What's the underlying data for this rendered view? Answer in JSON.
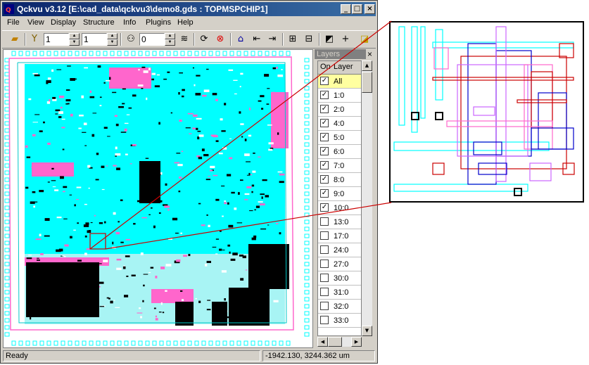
{
  "window": {
    "title": "Qckvu v3.12 [E:\\cad_data\\qckvu3\\demo8.gds : TOPMSPCHIP1]",
    "controls": {
      "minimize": "_",
      "maximize": "□",
      "close": "×"
    }
  },
  "menu": {
    "items": [
      "File",
      "View",
      "Display",
      "Structure",
      "Info",
      "Plugins",
      "Help"
    ]
  },
  "toolbar": {
    "spin1_value": "1",
    "spin2_value": "1",
    "spin3_value": "0"
  },
  "layers_panel": {
    "title": "Layers",
    "close": "×",
    "col_on": "On",
    "col_layer": "Layer",
    "rows": [
      {
        "name": "All",
        "checked": true,
        "selected": true
      },
      {
        "name": "1:0",
        "checked": true
      },
      {
        "name": "2:0",
        "checked": true
      },
      {
        "name": "4:0",
        "checked": true
      },
      {
        "name": "5:0",
        "checked": true
      },
      {
        "name": "6:0",
        "checked": true
      },
      {
        "name": "7:0",
        "checked": true
      },
      {
        "name": "8:0",
        "checked": true
      },
      {
        "name": "9:0",
        "checked": true
      },
      {
        "name": "10:0",
        "checked": true
      },
      {
        "name": "13:0",
        "checked": false
      },
      {
        "name": "17:0",
        "checked": false
      },
      {
        "name": "24:0",
        "checked": false
      },
      {
        "name": "27:0",
        "checked": false
      },
      {
        "name": "30:0",
        "checked": false
      },
      {
        "name": "31:0",
        "checked": false
      },
      {
        "name": "32:0",
        "checked": false
      },
      {
        "name": "33:0",
        "checked": false
      }
    ]
  },
  "status": {
    "message": "Ready",
    "coordinates": "-1942.130, 3244.362 um"
  },
  "colors": {
    "cyan": "#00ffff",
    "magenta": "#ff66cc",
    "red": "#cc0000",
    "blue": "#0000cc",
    "violet": "#cc66ff",
    "black": "#000000"
  }
}
